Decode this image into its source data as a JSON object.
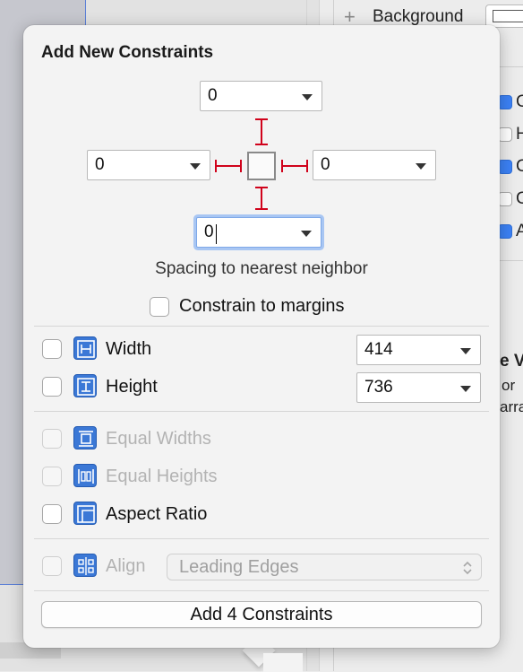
{
  "inspector": {
    "background_label": "Background",
    "letters": [
      "C",
      "H",
      "C",
      "C",
      "A"
    ],
    "view_title_fragment": "e Vi",
    "text_fragment_1": "or",
    "text_fragment_2": "arra"
  },
  "popover": {
    "title": "Add New Constraints",
    "spacing": {
      "top": "0",
      "left": "0",
      "right": "0",
      "bottom": "0",
      "caption": "Spacing to nearest neighbor"
    },
    "constrain_to_margins": {
      "label": "Constrain to margins",
      "checked": false
    },
    "width": {
      "label": "Width",
      "value": "414",
      "checked": false
    },
    "height": {
      "label": "Height",
      "value": "736",
      "checked": false
    },
    "equal_widths": {
      "label": "Equal Widths",
      "enabled": false
    },
    "equal_heights": {
      "label": "Equal Heights",
      "enabled": false
    },
    "aspect_ratio": {
      "label": "Aspect Ratio",
      "checked": false
    },
    "align": {
      "label": "Align",
      "selected": "Leading Edges",
      "enabled": false
    },
    "add_button_label": "Add 4 Constraints"
  },
  "colors": {
    "constraint_red": "#d0021b",
    "icon_blue": "#3b78d6",
    "focus_ring": "#a8c6f3"
  }
}
